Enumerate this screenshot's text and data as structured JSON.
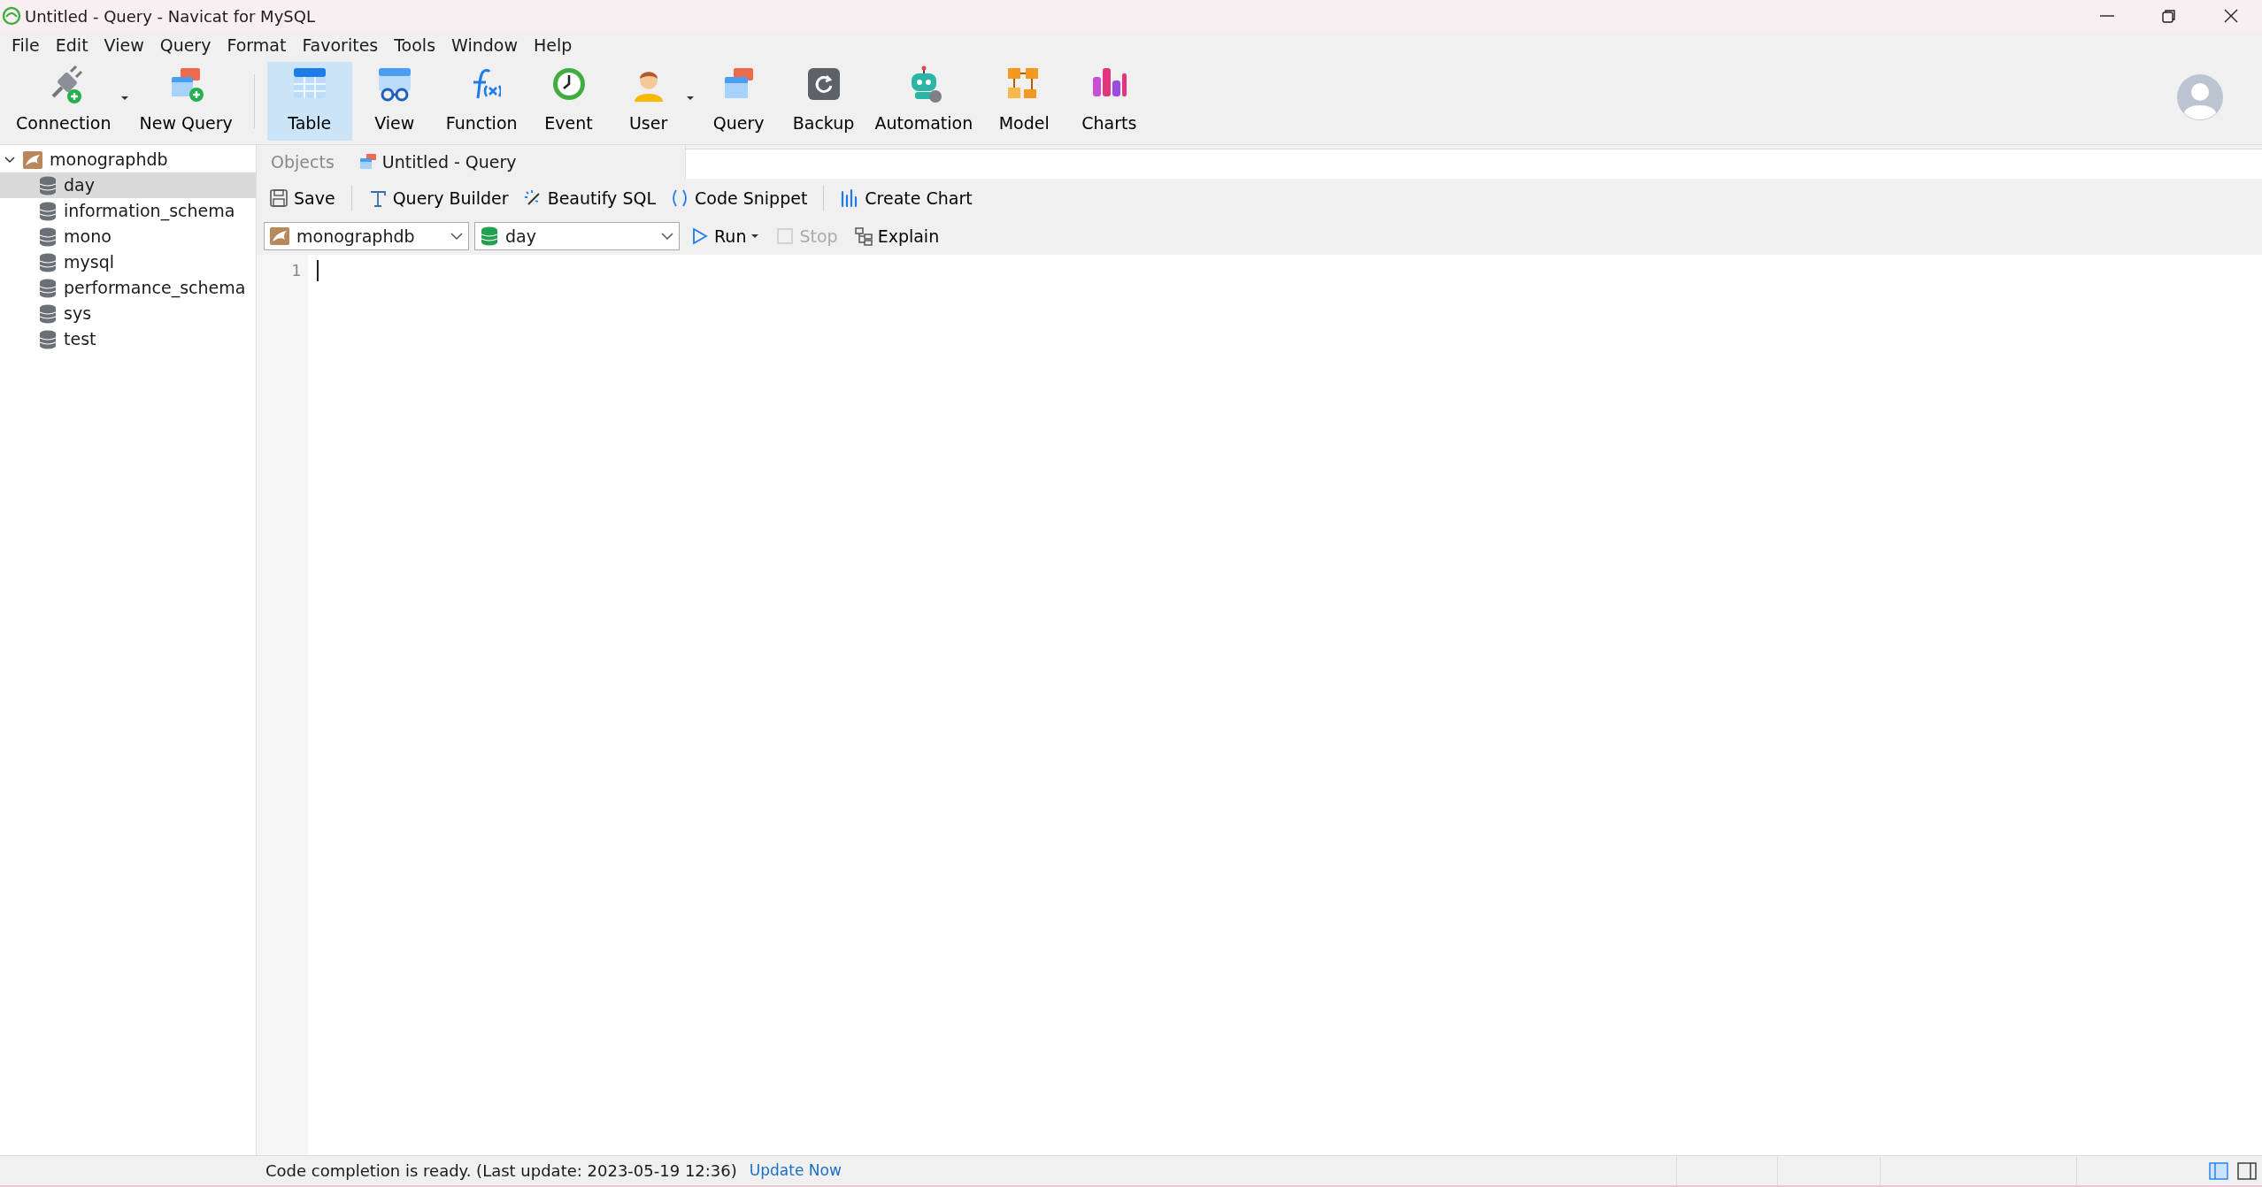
{
  "window": {
    "title": "Untitled - Query - Navicat for MySQL"
  },
  "menu": [
    "File",
    "Edit",
    "View",
    "Query",
    "Format",
    "Favorites",
    "Tools",
    "Window",
    "Help"
  ],
  "toolbar": [
    {
      "label": "Connection",
      "dropdown": true,
      "selected": false
    },
    {
      "label": "New Query",
      "dropdown": false,
      "selected": false
    },
    {
      "label": "Table",
      "dropdown": false,
      "selected": true
    },
    {
      "label": "View",
      "dropdown": false,
      "selected": false
    },
    {
      "label": "Function",
      "dropdown": false,
      "selected": false
    },
    {
      "label": "Event",
      "dropdown": false,
      "selected": false
    },
    {
      "label": "User",
      "dropdown": true,
      "selected": false
    },
    {
      "label": "Query",
      "dropdown": false,
      "selected": false
    },
    {
      "label": "Backup",
      "dropdown": false,
      "selected": false
    },
    {
      "label": "Automation",
      "dropdown": false,
      "selected": false
    },
    {
      "label": "Model",
      "dropdown": false,
      "selected": false
    },
    {
      "label": "Charts",
      "dropdown": false,
      "selected": false
    }
  ],
  "sidebar": {
    "tree": [
      {
        "label": "monographdb",
        "expanded": true,
        "children": [
          {
            "label": "day",
            "selected": true
          },
          {
            "label": "information_schema",
            "selected": false
          },
          {
            "label": "mono",
            "selected": false
          },
          {
            "label": "mysql",
            "selected": false
          },
          {
            "label": "performance_schema",
            "selected": false
          },
          {
            "label": "sys",
            "selected": false
          },
          {
            "label": "test",
            "selected": false
          }
        ]
      }
    ]
  },
  "tabs": [
    {
      "label": "Objects",
      "selected": false
    },
    {
      "label": "Untitled - Query",
      "selected": true
    }
  ],
  "query_toolbar": [
    "Save",
    "Query Builder",
    "Beautify SQL",
    "Code Snippet",
    "Create Chart"
  ],
  "run_bar": {
    "connection": "monographdb",
    "database": "day",
    "buttons": [
      {
        "label": "Run",
        "dropdown": true,
        "disabled": false
      },
      {
        "label": "Stop",
        "dropdown": false,
        "disabled": true
      },
      {
        "label": "Explain",
        "dropdown": false,
        "disabled": false
      }
    ]
  },
  "editor": {
    "line_numbers": [
      "1"
    ]
  },
  "status_bar": {
    "message": "Code completion is ready. (Last update: 2023-05-19 12:36)",
    "link": "Update Now"
  }
}
